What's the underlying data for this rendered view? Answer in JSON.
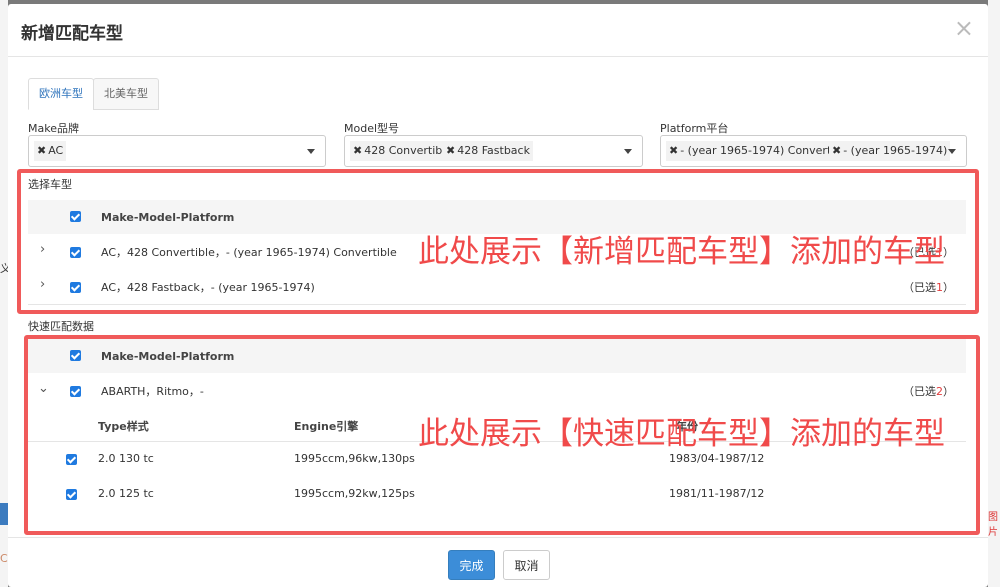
{
  "background": {
    "left_fragment": "义",
    "left_bottom_fragment": "C",
    "right_bottom_fragment": "图片"
  },
  "modal": {
    "title": "新增匹配车型",
    "close_glyph": "×"
  },
  "tabs": [
    {
      "label": "欧洲车型",
      "active": true
    },
    {
      "label": "北美车型",
      "active": false
    }
  ],
  "filters": {
    "make": {
      "label": "Make品牌",
      "chips": [
        "AC"
      ]
    },
    "model": {
      "label": "Model型号",
      "chips": [
        "428 Convertible",
        "428 Fastback"
      ]
    },
    "platform": {
      "label": "Platform平台",
      "chips": [
        "- (year 1965-1974) Convertible",
        "- (year 1965-1974)"
      ]
    },
    "chip_remove_glyph": "✖"
  },
  "selected_section": {
    "title": "选择车型",
    "header": "Make-Model-Platform",
    "rows": [
      {
        "text": "AC，428 Convertible，- (year 1965-1974) Convertible",
        "count_prefix": "（已选",
        "count": "1",
        "count_suffix": "）"
      },
      {
        "text": "AC，428 Fastback，- (year 1965-1974)",
        "count_prefix": "（已选",
        "count": "1",
        "count_suffix": "）"
      }
    ],
    "annotation": "此处展示【新增匹配车型】添加的车型"
  },
  "quick_section": {
    "title": "快速匹配数据",
    "header": "Make-Model-Platform",
    "group_row": {
      "text": "ABARTH，Ritmo，-",
      "count_prefix": "（已选",
      "count": "2",
      "count_suffix": "）"
    },
    "sub_headers": {
      "type": "Type样式",
      "engine": "Engine引擎",
      "year": "年份"
    },
    "sub_rows": [
      {
        "type": "2.0 130 tc",
        "engine": "1995ccm,96kw,130ps",
        "year": "1983/04-1987/12"
      },
      {
        "type": "2.0 125 tc",
        "engine": "1995ccm,92kw,125ps",
        "year": "1981/11-1987/12"
      }
    ],
    "annotation": "此处展示【快速匹配车型】添加的车型"
  },
  "footer": {
    "confirm_label": "完成",
    "cancel_label": "取消"
  },
  "colors": {
    "accent": "#3c8dd8",
    "annotation_red": "#f05a5a",
    "count_red": "#e23c3c"
  }
}
